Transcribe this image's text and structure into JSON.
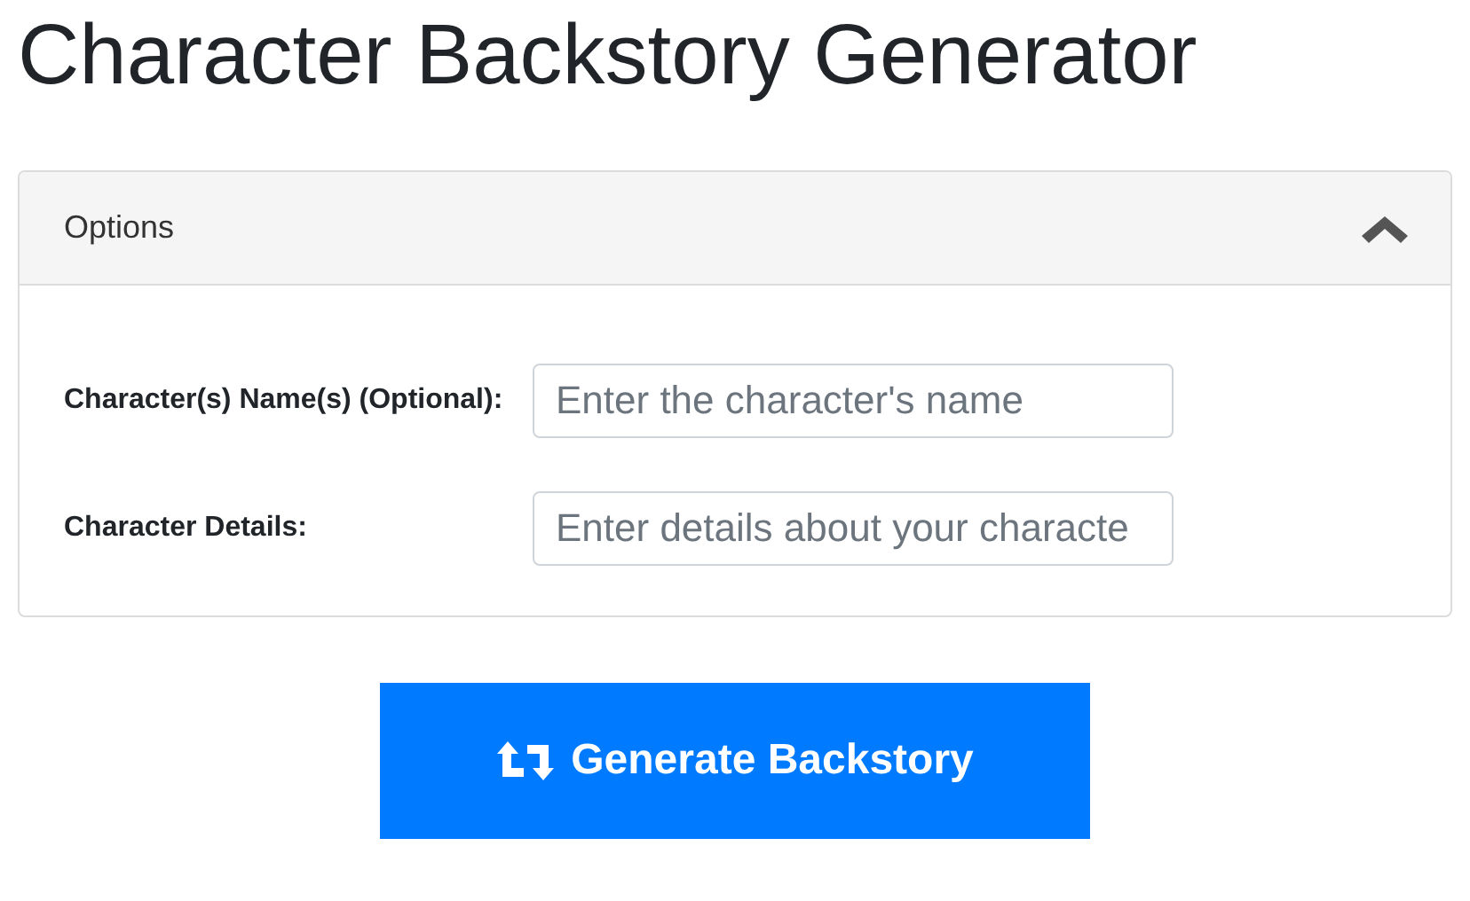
{
  "title": "Character Backstory Generator",
  "options_panel": {
    "title": "Options",
    "expanded": true,
    "fields": [
      {
        "label": "Character(s) Name(s) (Optional):",
        "placeholder": "Enter the character's name"
      },
      {
        "label": "Character Details:",
        "placeholder": "Enter details about your characte"
      }
    ]
  },
  "generate_button": {
    "label": "Generate Backstory"
  }
}
